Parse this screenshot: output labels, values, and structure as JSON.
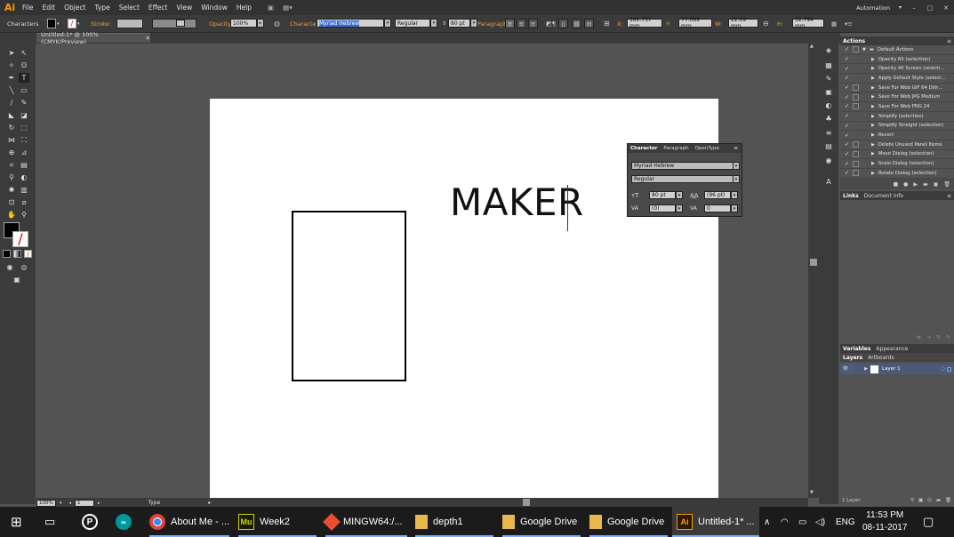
{
  "app": {
    "logo": "Ai",
    "workspace": "Automation"
  },
  "menu": [
    "File",
    "Edit",
    "Object",
    "Type",
    "Select",
    "Effect",
    "View",
    "Window",
    "Help"
  ],
  "control_bar": {
    "mode": "Characters",
    "stroke_label": "Stroke:",
    "opacity_label": "Opacity:",
    "opacity_value": "100%",
    "character_label": "Character:",
    "font_value": "Myriad Hebrew",
    "style_value": "Regular",
    "size_value": "80 pt",
    "paragraph_label": "Paragraph:",
    "x_label": "X:",
    "x_value": "181.737 mm",
    "y_label": "Y:",
    "y_value": "77.089 mm",
    "w_label": "W:",
    "w_value": "22.69 mm",
    "h_label": "H:",
    "h_value": "32.794 mm"
  },
  "document": {
    "tab_title": "Untitled-1* @ 100% (CMYK/Preview)"
  },
  "artboard": {
    "text": "MAKER"
  },
  "status_bar": {
    "zoom": "100%",
    "page": "1",
    "tool": "Type"
  },
  "character_panel": {
    "tabs": [
      "Character",
      "Paragraph",
      "OpenType"
    ],
    "font": "Myriad Hebrew",
    "style": "Regular",
    "size": "80 pt",
    "leading": "(96 pt)",
    "kerning": "(0)",
    "tracking": "0"
  },
  "actions_panel": {
    "title": "Actions",
    "set_name": "Default Actions",
    "items": [
      "Opacity 60 (selection)",
      "Opacity 40 Screen (selecti...",
      "Apply Default Style (select...",
      "Save For Web GIF 64 Dith...",
      "Save For Web JPG Medium",
      "Save For Web PNG 24",
      "Simplify (selection)",
      "Simplify Straight (selection)",
      "Revert",
      "Delete Unused Panel Items",
      "Move Dialog (selection)",
      "Scale Dialog (selection)",
      "Rotate Dialog (selection)"
    ]
  },
  "links_panel": {
    "tabs": [
      "Links",
      "Document Info"
    ]
  },
  "variables_panel": {
    "tabs": [
      "Variables",
      "Appearance"
    ]
  },
  "layers_panel": {
    "tabs": [
      "Layers",
      "Artboards"
    ],
    "layer_name": "Layer 1",
    "footer": "1 Layer"
  },
  "taskbar": {
    "apps": [
      "About Me - ...",
      "Week2",
      "MINGW64:/...",
      "depth1",
      "Google Drive",
      "Google Drive",
      "Untitled-1* ..."
    ],
    "language": "ENG",
    "time": "11:53 PM",
    "date": "08-11-2017"
  }
}
